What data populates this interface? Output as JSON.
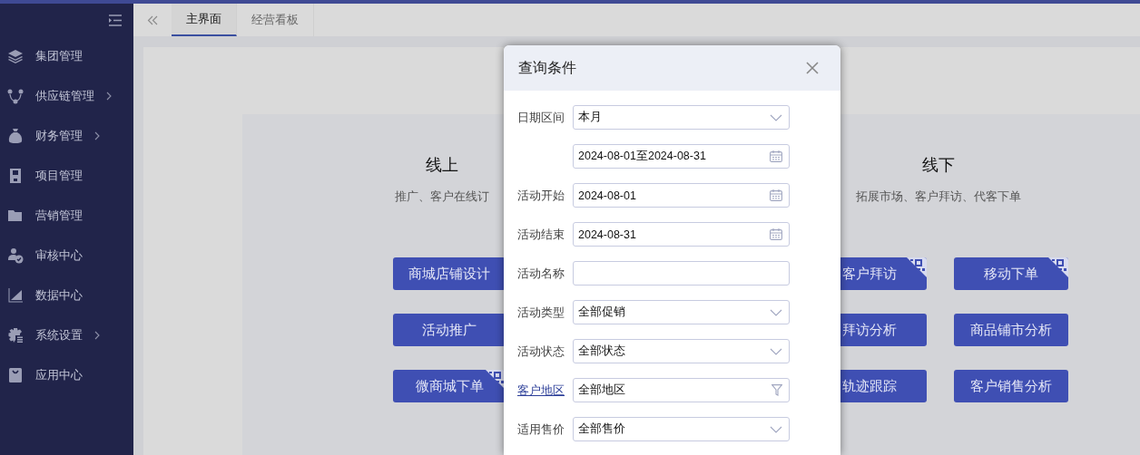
{
  "sidebar": {
    "items": [
      {
        "label": "集团管理",
        "has_submenu": false
      },
      {
        "label": "供应链管理",
        "has_submenu": true
      },
      {
        "label": "财务管理",
        "has_submenu": true
      },
      {
        "label": "项目管理",
        "has_submenu": false
      },
      {
        "label": "营销管理",
        "has_submenu": false
      },
      {
        "label": "审核中心",
        "has_submenu": false
      },
      {
        "label": "数据中心",
        "has_submenu": false
      },
      {
        "label": "系统设置",
        "has_submenu": true
      },
      {
        "label": "应用中心",
        "has_submenu": false
      }
    ]
  },
  "tabs": [
    {
      "label": "主界面",
      "selected": true
    },
    {
      "label": "经营看板",
      "selected": false
    }
  ],
  "sections": [
    {
      "title": "线上",
      "subtitle": "推广、客户在线订",
      "buttons": [
        {
          "label": "商城店铺设计",
          "qr_badge": false
        },
        {
          "label": "活动推广",
          "qr_badge": false
        },
        {
          "label": "微商城下单",
          "qr_badge": true
        }
      ]
    },
    {
      "title": "线下",
      "subtitle": "拓展市场、客户拜访、代客下单",
      "buttons": [
        {
          "label": "客户拜访",
          "qr_badge": true
        },
        {
          "label": "移动下单",
          "qr_badge": true
        },
        {
          "label": "拜访分析",
          "qr_badge": false
        },
        {
          "label": "商品铺市分析",
          "qr_badge": false
        },
        {
          "label": "轨迹跟踪",
          "qr_badge": false
        },
        {
          "label": "客户销售分析",
          "qr_badge": false
        }
      ]
    }
  ],
  "dialog": {
    "title": "查询条件",
    "fields": [
      {
        "label": "日期区间",
        "kind": "select",
        "value": "本月",
        "label_link": false
      },
      {
        "kind": "date",
        "value": "2024-08-01至2024-08-31"
      },
      {
        "label": "活动开始",
        "kind": "date",
        "value": "2024-08-01",
        "label_link": false
      },
      {
        "label": "活动结束",
        "kind": "date",
        "value": "2024-08-31",
        "label_link": false
      },
      {
        "label": "活动名称",
        "kind": "text",
        "label_link": false
      },
      {
        "label": "活动类型",
        "kind": "select",
        "value": "全部促销",
        "label_link": false
      },
      {
        "label": "活动状态",
        "kind": "select",
        "value": "全部状态",
        "label_link": false
      },
      {
        "label": "客户地区",
        "kind": "filter",
        "value": "全部地区",
        "label_link": true
      },
      {
        "label": "适用售价",
        "kind": "select",
        "value": "全部售价",
        "label_link": false
      }
    ]
  }
}
